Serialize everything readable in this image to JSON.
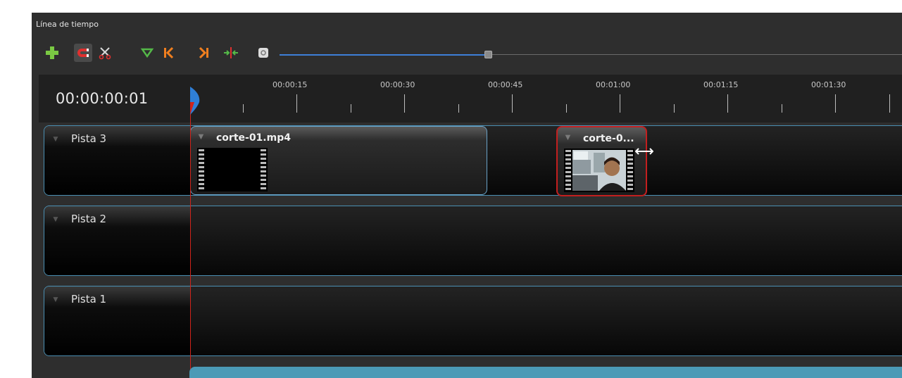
{
  "panel": {
    "title": "Línea de tiempo"
  },
  "toolbar": {
    "buttons": [
      {
        "icon": "add-track-icon",
        "color": "#7ac943"
      },
      {
        "icon": "snap-magnet-icon",
        "color": "#e0302f",
        "active": true
      },
      {
        "icon": "razor-scissors-icon",
        "color": "#e0302f"
      },
      {
        "icon": "add-marker-icon",
        "color": "#54b948"
      },
      {
        "icon": "previous-marker-icon",
        "color": "#f07f1f"
      },
      {
        "icon": "next-marker-icon",
        "color": "#f07f1f"
      },
      {
        "icon": "center-playhead-icon",
        "color": "#e0302f"
      },
      {
        "icon": "zoom-out-icon",
        "color": "#dddddd"
      }
    ],
    "zoom_level": 0.35
  },
  "ruler": {
    "current_time": "00:00:00:01",
    "tick_labels": [
      "00:00:15",
      "00:00:30",
      "00:00:45",
      "00:01:00",
      "00:01:15",
      "00:01:30"
    ]
  },
  "tracks": [
    {
      "label": "Pista 3"
    },
    {
      "label": "Pista 2"
    },
    {
      "label": "Pista 1"
    }
  ],
  "clips": [
    {
      "title": "corte-01.mp4",
      "track": "Pista 3",
      "selected": false
    },
    {
      "title": "corte-0...",
      "track": "Pista 3",
      "selected": true
    }
  ],
  "colors": {
    "accent_blue": "#3d7fd8",
    "track_border": "#4a8fb3",
    "selected_clip_border": "#c31f1f",
    "playhead": "#d0241b"
  }
}
